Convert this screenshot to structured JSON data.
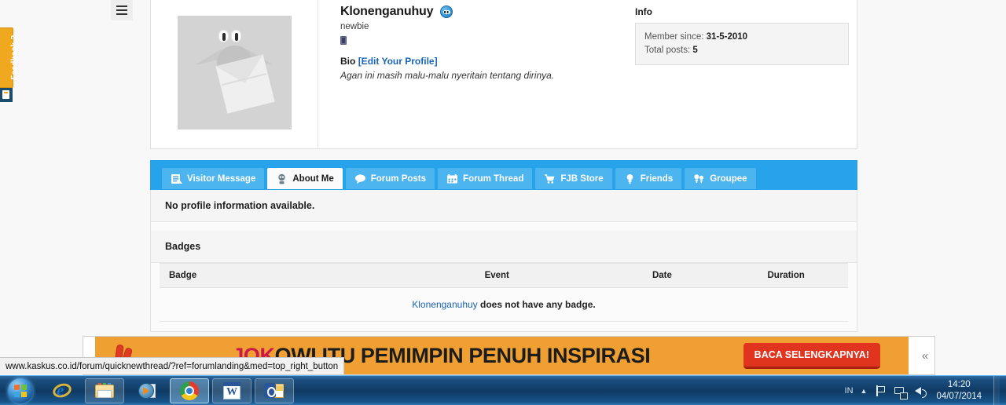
{
  "browser": {
    "status_url": "www.kaskus.co.id/forum/quicknewthread/?ref=forumlanding&med=top_right_button"
  },
  "feedback": {
    "label": "Feedback ?"
  },
  "profile": {
    "username": "Klonenganuhuy",
    "usertitle": "newbie",
    "bio_label": "Bio",
    "edit_link": "[Edit Your Profile]",
    "bio_text": "Agan ini masih malu-malu nyeritain tentang dirinya."
  },
  "info": {
    "heading": "Info",
    "member_since_label": "Member since:",
    "member_since_value": "31-5-2010",
    "total_posts_label": "Total posts:",
    "total_posts_value": "5"
  },
  "tabs": [
    {
      "label": "Visitor Message",
      "icon": "document-lines-icon",
      "active": false
    },
    {
      "label": "About Me",
      "icon": "person-bust-icon",
      "active": true
    },
    {
      "label": "Forum Posts",
      "icon": "speech-bubble-icon",
      "active": false
    },
    {
      "label": "Forum Thread",
      "icon": "calendar-icon",
      "active": false
    },
    {
      "label": "FJB Store",
      "icon": "shopping-cart-icon",
      "active": false
    },
    {
      "label": "Friends",
      "icon": "person-icon",
      "active": false
    },
    {
      "label": "Groupee",
      "icon": "people-group-icon",
      "active": false
    }
  ],
  "panel": {
    "no_profile_info": "No profile information available.",
    "badges_heading": "Badges"
  },
  "badges_table": {
    "headers": [
      "Badge",
      "Event",
      "Date",
      "Duration"
    ],
    "empty_message_user": "Klonenganuhuy",
    "empty_message_rest": " does not have any badge."
  },
  "ad": {
    "headline_highlight": "JOK",
    "headline_rest": "OWI ITU PEMIMPIN PENUH INSPIRASI",
    "cta": "BACA SELENGKAPNYA!",
    "collapse": "«",
    "logo": "hand-victory-icon"
  },
  "taskbar": {
    "start": "windows-start-orb",
    "items": [
      {
        "name": "internet-explorer",
        "state": "quicklaunch"
      },
      {
        "name": "windows-explorer",
        "state": "pinned"
      },
      {
        "name": "windows-media-player",
        "state": "quicklaunch"
      },
      {
        "name": "google-chrome",
        "state": "active"
      },
      {
        "name": "microsoft-word",
        "state": "pinned"
      },
      {
        "name": "microsoft-outlook",
        "state": "pinned"
      }
    ],
    "tray": {
      "language": "IN",
      "show_hidden": "▲",
      "time": "14:20",
      "date": "04/07/2014"
    }
  },
  "colors": {
    "tab_active_blue": "#27a3eb",
    "link_blue": "#1a64b5",
    "ad_orange": "#f0a032",
    "ad_cta_red": "#e0341f",
    "feedback_orange": "#f0a81e"
  }
}
